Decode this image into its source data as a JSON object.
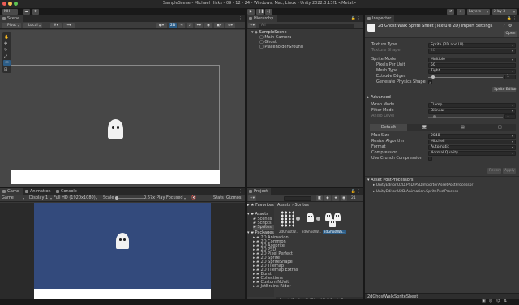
{
  "titlebar": {
    "title": "SampleScene - Michael Hicks - 09 - 12 - 24 - Windows, Mac, Linux - Unity 2022.3.13f1 <Metal>",
    "account": "MH",
    "layers": "Layers",
    "layout": "2 by 3"
  },
  "scene": {
    "tab": "Scene",
    "pivot": "Pivot",
    "local": "Local",
    "mode_2d": "2D"
  },
  "game": {
    "tabs": [
      "Game",
      "Animation",
      "Console"
    ],
    "view": "Game",
    "display": "Display 1",
    "resolution": "Full HD (1920x1080)",
    "scale_label": "Scale",
    "scale_value": "0.67x",
    "play_mode": "Play Focused",
    "stats": "Stats",
    "gizmos": "Gizmos",
    "bg_color": "#334a7c"
  },
  "hierarchy": {
    "tab": "Hierarchy",
    "search_placeholder": "All",
    "scene_name": "SampleScene",
    "items": [
      "Main Camera",
      "Ghost",
      "PlaceholderGround"
    ]
  },
  "project": {
    "tab": "Project",
    "sidebar_favorites": "Favorites",
    "sidebar_assets": "Assets",
    "assets_children": [
      "Scenes",
      "Scripts",
      "Sprites"
    ],
    "packages": "Packages",
    "package_items": [
      "2D Animation",
      "2D Common",
      "2D Aseprite",
      "2D PSD",
      "2D Pixel Perfect",
      "2D Sprite",
      "2D SpriteShape",
      "2D Tilemap",
      "2D Tilemap Extras",
      "Burst",
      "Collections",
      "Custom NUnit",
      "JetBrains Rider"
    ],
    "breadcrumb": [
      "Assets",
      "Sprites"
    ],
    "assets": [
      "2dGhostW...",
      "2dGhostW...",
      "2dGhostWa..."
    ],
    "asset_count": "21",
    "footer_path": "Assets/Sprites/2dGhostWalkSpriteS..."
  },
  "inspector": {
    "tab": "Inspector",
    "title": "2d Ghost Walk Sprite Sheet (Texture 2D) Import Settings",
    "open_label": "Open",
    "rows": [
      {
        "label": "Texture Type",
        "value": "Sprite (2D and UI)"
      },
      {
        "label": "Texture Shape",
        "value": "2D"
      },
      {
        "label": "Sprite Mode",
        "value": "Multiple"
      },
      {
        "label": "Pixels Per Unit",
        "value": "50"
      },
      {
        "label": "Mesh Type",
        "value": "Tight"
      },
      {
        "label": "Extrude Edges",
        "value": "1"
      },
      {
        "label": "Generate Physics Shape",
        "value": ""
      }
    ],
    "sprite_editor": "Sprite Editor",
    "advanced": "Advanced",
    "wrap_rows": [
      {
        "label": "Wrap Mode",
        "value": "Clamp"
      },
      {
        "label": "Filter Mode",
        "value": "Bilinear"
      },
      {
        "label": "Aniso Level",
        "value": "1"
      }
    ],
    "platform_default": "Default",
    "platform_rows": [
      {
        "label": "Max Size",
        "value": "2048"
      },
      {
        "label": "Resize Algorithm",
        "value": "Mitchell"
      },
      {
        "label": "Format",
        "value": "Automatic"
      },
      {
        "label": "Compression",
        "value": "Normal Quality"
      },
      {
        "label": "Use Crunch Compression",
        "value": ""
      }
    ],
    "revert": "Revert",
    "apply": "Apply",
    "postprocessors_title": "Asset PostProcessors",
    "postprocessors": [
      "UnityEditor.U2D.PSD.PSDImporterAssetPostProcessor",
      "UnityEditor.U2D.Animation.SpritePostProcess"
    ],
    "footer": "2dGhostWalkSpriteSheet"
  },
  "colors": {
    "accent": "#2c5d87",
    "ghost": "#f2f2f2",
    "scene_bg": "#474747"
  }
}
